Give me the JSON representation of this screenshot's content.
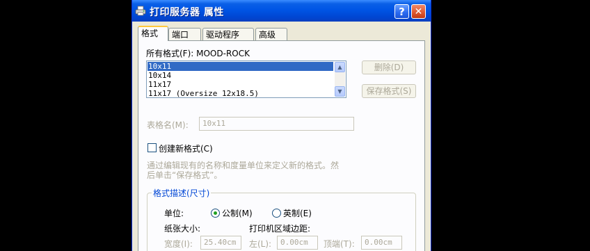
{
  "window": {
    "title": "打印服务器 属性",
    "help_label": "?",
    "close_label": "✕"
  },
  "tabs": [
    {
      "label": "格式",
      "active": true
    },
    {
      "label": "端口",
      "active": false
    },
    {
      "label": "驱动程序",
      "active": false
    },
    {
      "label": "高级",
      "active": false
    }
  ],
  "formats": {
    "label": "所有格式(F): MOOD-ROCK",
    "items": [
      "10x11",
      "10x14",
      "11x17",
      "11x17 (Oversize 12x18.5)"
    ],
    "selected": "10x11",
    "delete_label": "删除(D)",
    "save_label": "保存格式(S)"
  },
  "form_name": {
    "label": "表格名(M):",
    "value": "10x11"
  },
  "create_new": {
    "label": "创建新格式(C)",
    "checked": false,
    "help_line1": "通过编辑现有的名称和度量单位来定义新的格式。然",
    "help_line2": "后单击“保存格式”。"
  },
  "description": {
    "title": "格式描述(尺寸)",
    "unit_label": "单位:",
    "metric_label": "公制(M)",
    "english_label": "英制(E)",
    "selected_unit": "metric",
    "paper_size_label": "纸张大小:",
    "margins_label": "打印机区域边距:",
    "width_label": "宽度(I):",
    "width_value": "25.40cm",
    "left_label": "左(L):",
    "left_value": "0.00cm",
    "top_label": "顶端(T):",
    "top_value": "0.00cm"
  },
  "colors": {
    "titlebar": "#0055e5",
    "selection": "#316ac5",
    "group_title": "#0046d5",
    "disabled_text": "#aca899"
  }
}
